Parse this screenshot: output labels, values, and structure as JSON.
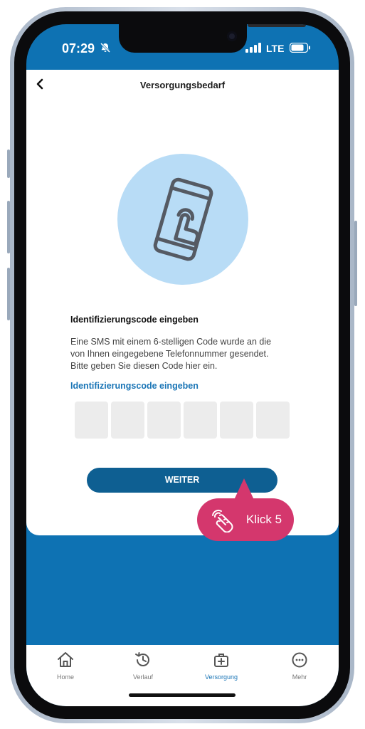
{
  "status_bar": {
    "time": "07:29",
    "network": "LTE"
  },
  "header": {
    "title": "Versorgungsbedarf"
  },
  "content": {
    "heading": "Identifizierungscode eingeben",
    "description": "Eine SMS mit einem 6-stelligen Code wurde an die\nvon Ihnen eingegebene Telefonnummer gesendet.\nBitte geben Sie diesen Code hier ein.",
    "code_label": "Identifizierungscode eingeben",
    "code_digits": [
      "",
      "",
      "",
      "",
      "",
      ""
    ],
    "button_label": "WEITER"
  },
  "annotation": {
    "label": "Klick 5"
  },
  "tabbar": {
    "items": [
      {
        "label": "Home",
        "icon": "home-icon"
      },
      {
        "label": "Verlauf",
        "icon": "history-icon"
      },
      {
        "label": "Versorgung",
        "icon": "medical-kit-icon"
      },
      {
        "label": "Mehr",
        "icon": "more-icon"
      }
    ],
    "active": "Versorgung"
  },
  "colors": {
    "primary": "#0e72b3",
    "button": "#0e5f92",
    "accent_link": "#1a75b6",
    "annotation": "#d4376d",
    "illustration_bg": "#b8dcf6"
  }
}
